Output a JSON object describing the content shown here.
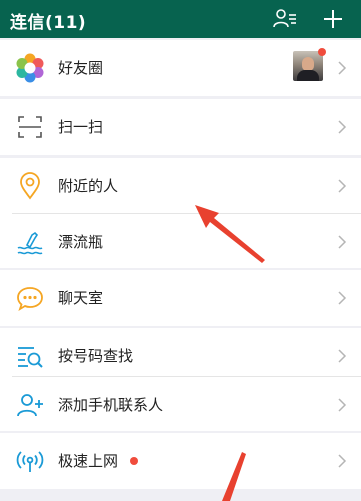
{
  "header": {
    "title": "连信(11)"
  },
  "rows": {
    "moments": {
      "label": "好友圈"
    },
    "scan": {
      "label": "扫一扫"
    },
    "nearby": {
      "label": "附近的人"
    },
    "drift_bottle": {
      "label": "漂流瓶"
    },
    "chat_room": {
      "label": "聊天室"
    },
    "find_by_number": {
      "label": "按号码查找"
    },
    "add_contacts": {
      "label": "添加手机联系人"
    },
    "speed_net": {
      "label": "极速上网"
    }
  },
  "colors": {
    "header_bg": "#07634f",
    "accent_teal": "#1aa88f",
    "badge_red": "#f04c3c",
    "annotation_arrow": "#e8412f"
  }
}
